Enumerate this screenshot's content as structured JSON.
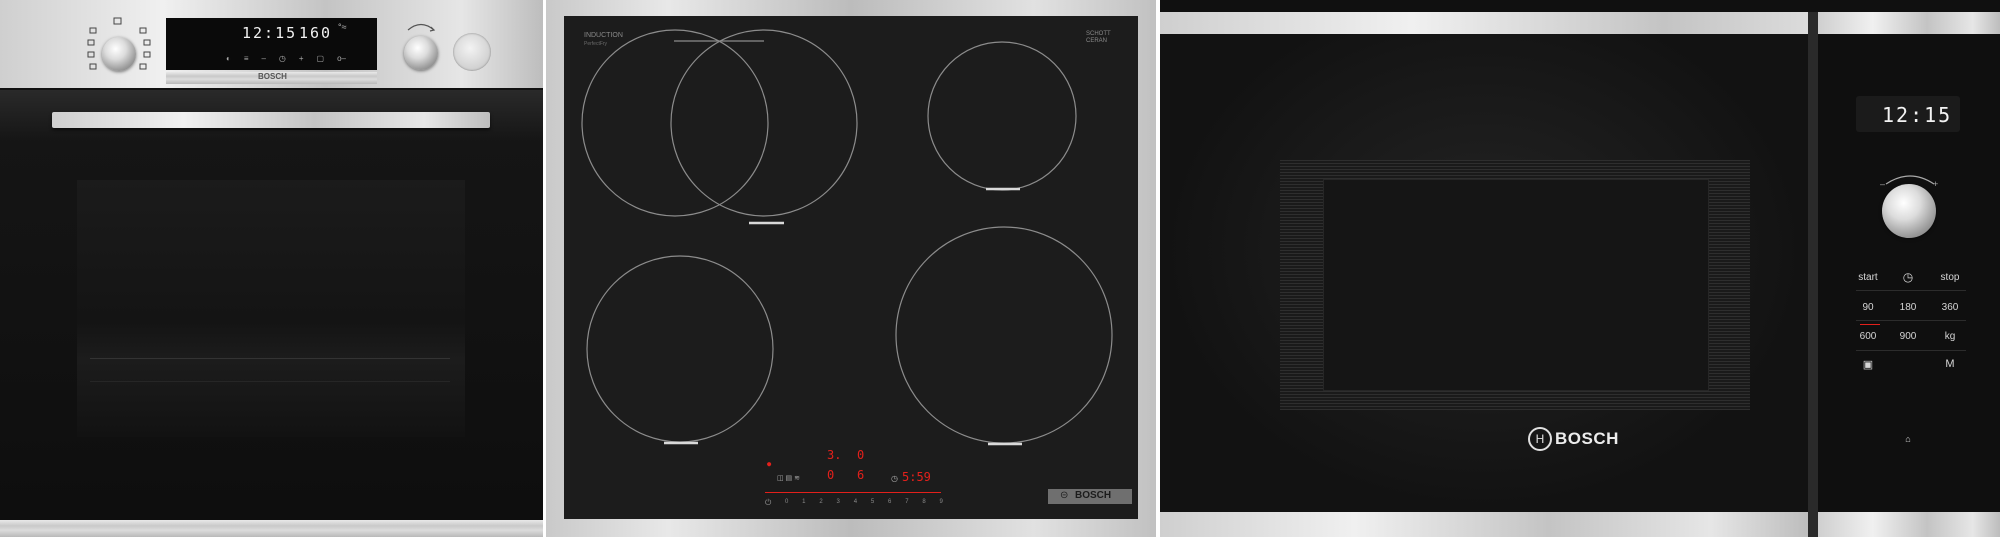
{
  "oven": {
    "clock": "12:15",
    "temperature": "160",
    "brand": "BOSCH",
    "icons": [
      "mode-selector-icon",
      "wifi-icon",
      "rotate-arrow-icon"
    ]
  },
  "hob": {
    "label_left": "INDUCTION",
    "label_left_sub": "PerfectFry",
    "label_right": "SCHOTT CERAN",
    "label_right_sub": "",
    "brand": "BOSCH",
    "readout_a": "3.",
    "readout_b": "0",
    "readout_c": "0",
    "readout_d": "6",
    "readout_time": "5:59",
    "slider_numbers": [
      "0",
      "1",
      "2",
      "3",
      "4",
      "5",
      "6",
      "7",
      "8",
      "9"
    ],
    "accent": "#e3201b"
  },
  "microwave": {
    "clock": "12:15",
    "brand": "BOSCH",
    "buttons": {
      "start": "start",
      "stop": "stop",
      "w90": "90",
      "w180": "180",
      "w360": "360",
      "w600": "600",
      "w900": "900",
      "kg": "kg",
      "memory": "M"
    }
  }
}
